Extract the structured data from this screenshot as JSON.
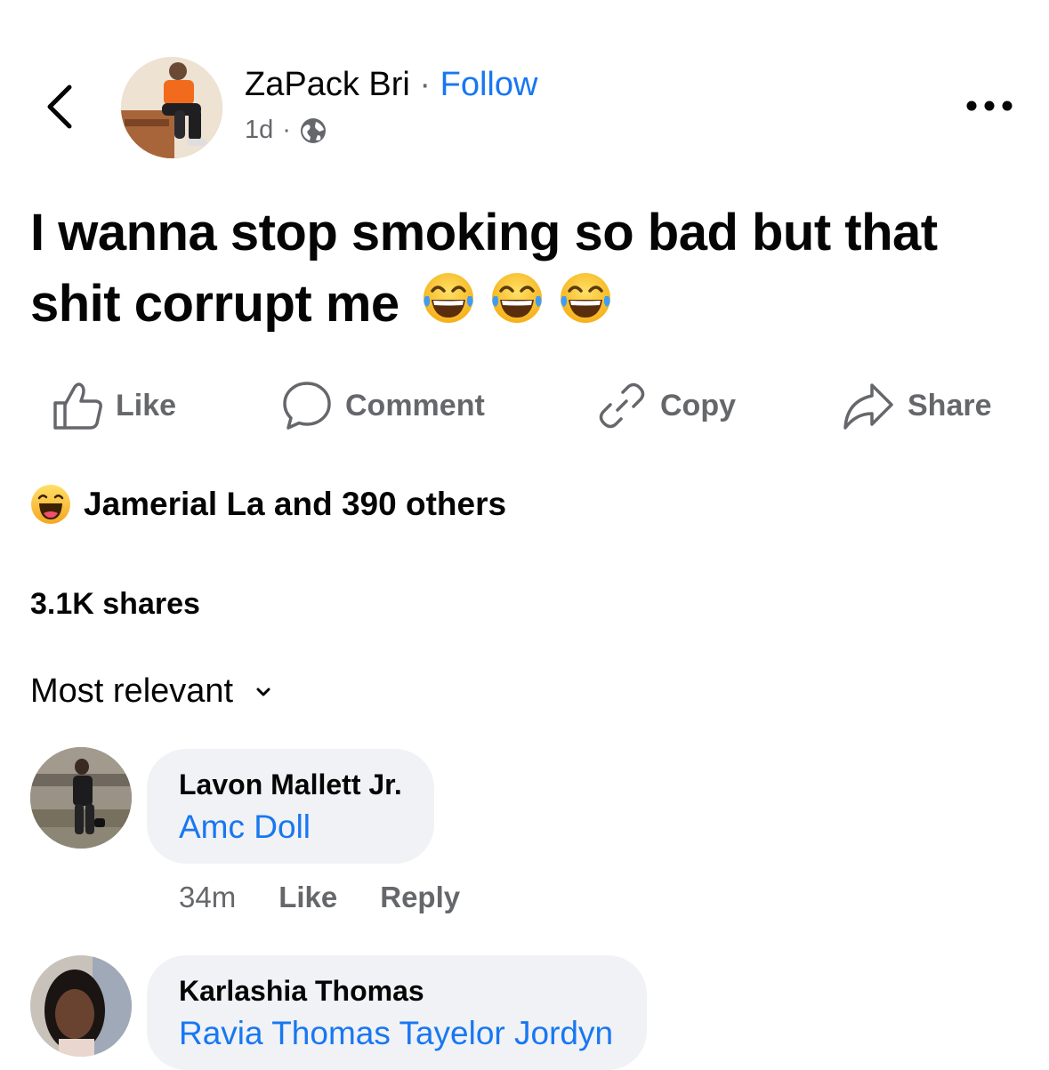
{
  "post": {
    "author": "ZaPack Bri",
    "separator": "·",
    "follow_label": "Follow",
    "time": "1d",
    "meta_dot": "·",
    "text": "I wanna stop smoking so bad but that shit corrupt me"
  },
  "actions": {
    "like": "Like",
    "comment": "Comment",
    "copy": "Copy",
    "share": "Share"
  },
  "reactions": {
    "summary": "Jamerial La and 390 others"
  },
  "shares": "3.1K shares",
  "sort": {
    "label": "Most relevant"
  },
  "comments": [
    {
      "name": "Lavon Mallett Jr.",
      "text": "Amc Doll",
      "time": "34m",
      "like_label": "Like",
      "reply_label": "Reply"
    },
    {
      "name": "Karlashia Thomas",
      "text": "Ravia Thomas Tayelor Jordyn"
    }
  ],
  "colors": {
    "accent": "#1877f2",
    "secondary_text": "#65676b",
    "bubble": "#f0f2f5"
  },
  "icons": [
    "back-chevron-icon",
    "globe-icon",
    "more-options-icon",
    "thumbs-up-icon",
    "comment-bubble-icon",
    "link-icon",
    "share-arrow-icon",
    "haha-reaction-icon",
    "laughing-tears-emoji",
    "chevron-down-icon"
  ]
}
